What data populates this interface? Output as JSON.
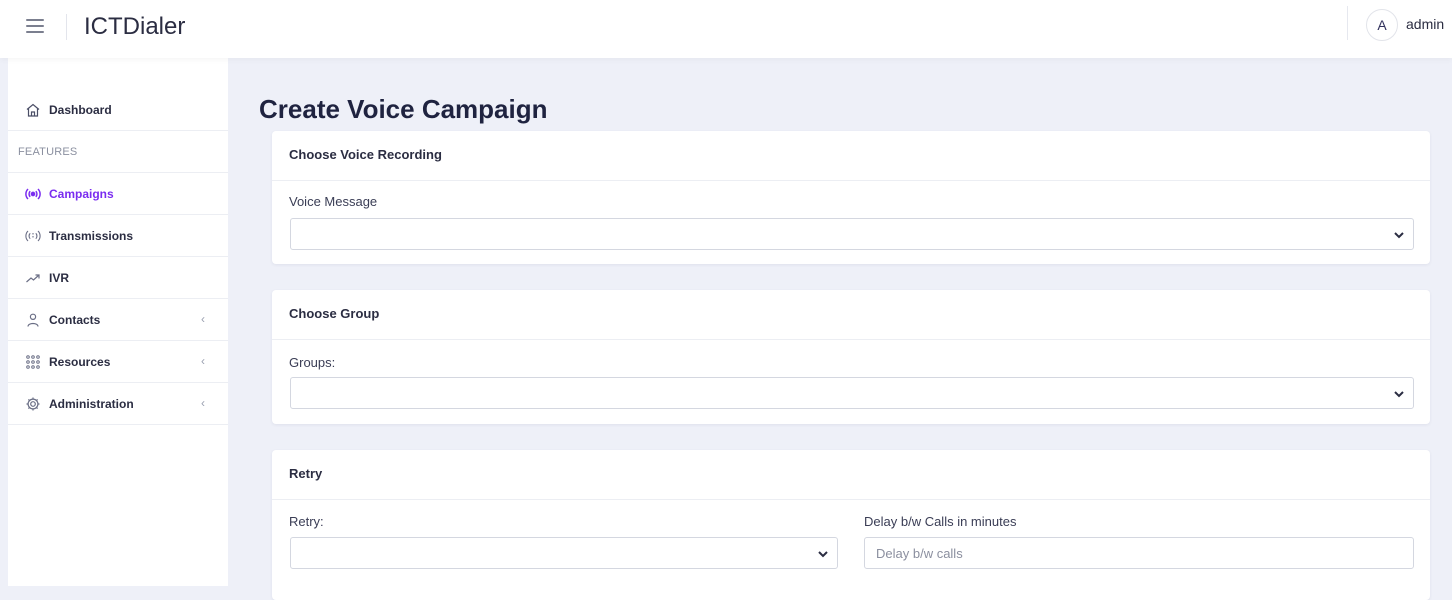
{
  "app": {
    "title": "ICTDialer"
  },
  "user": {
    "avatar_letter": "A",
    "name": "admin"
  },
  "sidebar": {
    "items": [
      {
        "label": "Dashboard",
        "icon": "home-icon"
      },
      {
        "label": "FEATURES"
      },
      {
        "label": "Campaigns",
        "icon": "broadcast-icon",
        "active": true
      },
      {
        "label": "Transmissions",
        "icon": "signal-icon"
      },
      {
        "label": "IVR",
        "icon": "trending-up-icon"
      },
      {
        "label": "Contacts",
        "icon": "user-icon",
        "expandable": true
      },
      {
        "label": "Resources",
        "icon": "grid-icon",
        "expandable": true
      },
      {
        "label": "Administration",
        "icon": "gear-icon",
        "expandable": true
      }
    ],
    "chevron": "‹"
  },
  "page": {
    "title": "Create Voice Campaign"
  },
  "cards": {
    "voice": {
      "header": "Choose Voice Recording",
      "label": "Voice Message",
      "value": ""
    },
    "group": {
      "header": "Choose Group",
      "label": "Groups:",
      "value": ""
    },
    "retry": {
      "header": "Retry",
      "retry_label": "Retry:",
      "retry_value": "",
      "delay_label": "Delay b/w Calls in minutes",
      "delay_placeholder": "Delay b/w calls",
      "delay_value": ""
    }
  },
  "colors": {
    "accent": "#7a2cf0",
    "background": "#eef0f8",
    "text": "#2b2d42"
  }
}
